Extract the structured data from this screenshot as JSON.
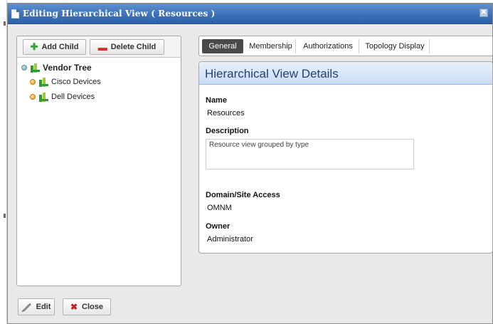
{
  "window": {
    "title": "Editing Hierarchical View ( Resources )",
    "close_glyph": "✕"
  },
  "left_toolbar": {
    "add_child_label": "Add Child",
    "delete_child_label": "Delete Child"
  },
  "tree": {
    "root_label": "Vendor Tree",
    "children": [
      "Cisco Devices",
      "Dell Devices"
    ]
  },
  "tabs": [
    "General",
    "Membership",
    "Authorizations",
    "Topology Display"
  ],
  "active_tab": "General",
  "details": {
    "title": "Hierarchical View Details",
    "name_label": "Name",
    "name_value": "Resources",
    "description_label": "Description",
    "description_value": "Resource view grouped by type",
    "domain_label": "Domain/Site Access",
    "domain_value": "OMNM",
    "owner_label": "Owner",
    "owner_value": "Administrator"
  },
  "footer": {
    "edit_label": "Edit",
    "close_label": "Close"
  },
  "colors": {
    "titlebar": "#3a6fb6",
    "details_header": "#c9dbf3",
    "active_tab": "#4a4a4a",
    "add_icon": "#3aa13a",
    "delete_icon": "#d23030",
    "close_icon": "#c02020"
  },
  "icons": {
    "title": "window-icon",
    "close": "close-icon",
    "add": "plus-icon",
    "delete": "minus-icon",
    "tree_node": "tree-hierarchy-icon",
    "tree_status": "status-orb-icon",
    "edit": "pencil-icon",
    "close_button": "x-icon"
  }
}
